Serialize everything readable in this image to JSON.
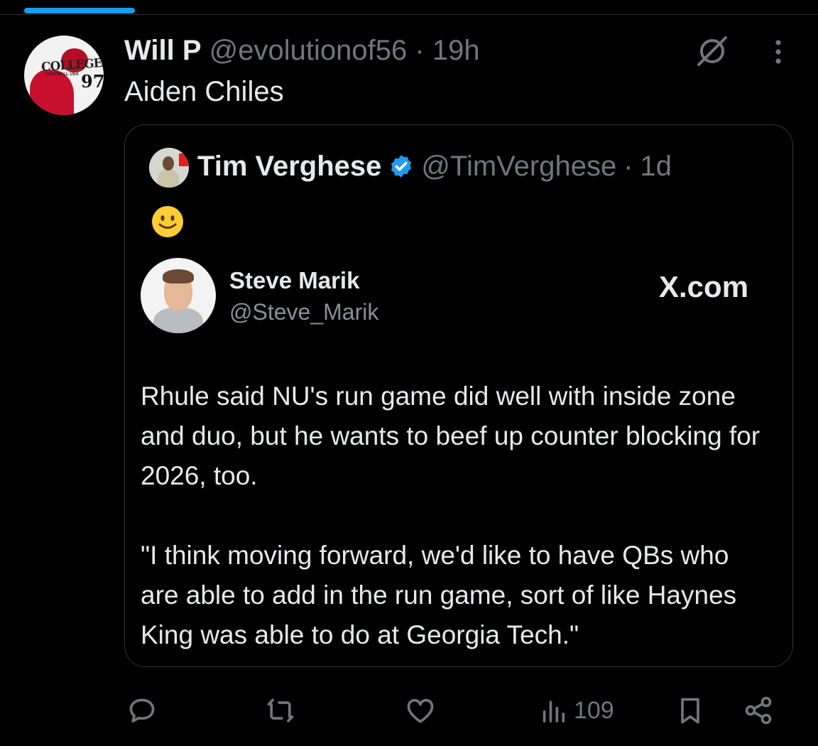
{
  "tweet": {
    "author_name": "Will P",
    "author_handle": "@evolutionof56",
    "separator": "·",
    "time": "19h",
    "text": "Aiden Chiles",
    "avatar_logo_text": "COLLEGE",
    "avatar_logo_sub": "FOOTBALL USA",
    "avatar_logo_number": "97"
  },
  "quoted": {
    "author_name": "Tim Verghese",
    "author_handle": "@TimVerghese",
    "separator": "·",
    "time": "1d",
    "emoji": "slightly-smiling-face",
    "embedded": {
      "name": "Steve Marik",
      "handle": "@Steve_Marik",
      "site": "X.com",
      "paragraphs": [
        "Rhule said NU's run game did well with inside zone and duo, but he wants to beef up counter blocking for 2026, too.",
        "\"I think moving forward, we'd like to have QBs who are able to add in the run game, sort of like Haynes King was able to do at Georgia Tech.\""
      ]
    }
  },
  "actions": {
    "views": "109"
  },
  "icons": [
    "grok-icon",
    "more-icon",
    "verified-badge-icon",
    "reply-icon",
    "repost-icon",
    "like-icon",
    "views-icon",
    "bookmark-icon",
    "share-icon"
  ],
  "colors": {
    "background": "#000000",
    "text": "#e7e9ea",
    "muted": "#71767b",
    "accent": "#1d9bf0",
    "border": "#2f3336"
  }
}
